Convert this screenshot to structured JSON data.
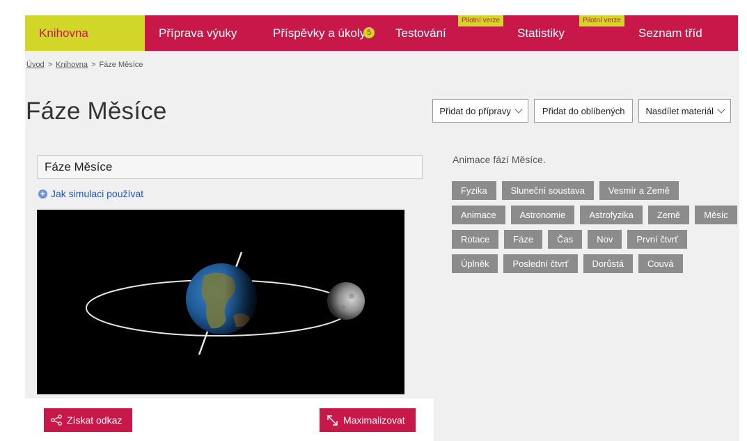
{
  "nav": {
    "items": [
      {
        "label": "Knihovna",
        "active": true
      },
      {
        "label": "Příprava výuky"
      },
      {
        "label": "Příspěvky a úkoly",
        "badge": "5"
      },
      {
        "label": "Testování",
        "pilot": "Pilotní verze"
      },
      {
        "label": "Statistiky",
        "pilot": "Pilotní verze"
      },
      {
        "label": "Seznam tříd"
      }
    ]
  },
  "breadcrumb": {
    "home": "Úvod",
    "sep1": ">",
    "library": "Knihovna",
    "sep2": ">",
    "current": "Fáze Měsíce"
  },
  "page_title": "Fáze Měsíce",
  "actions": {
    "add_to_prep": "Přidat do přípravy",
    "add_to_fav": "Přidat do oblíbených",
    "share": "Nasdílet materiál"
  },
  "material": {
    "title": "Fáze Měsíce",
    "howto": "Jak simulaci používat",
    "get_link": "Získat odkaz",
    "maximize": "Maximalizovat"
  },
  "description": "Animace fází Měsíce.",
  "tags": [
    "Fyzika",
    "Sluneční soustava",
    "Vesmír a Země",
    "Animace",
    "Astronomie",
    "Astrofyzika",
    "Země",
    "Měsíc",
    "Rotace",
    "Fáze",
    "Čas",
    "Nov",
    "První čtvrť",
    "Úplněk",
    "Poslední čtvrť",
    "Dorůstá",
    "Couvá"
  ],
  "colors": {
    "brand_red": "#c8184a",
    "brand_yellow": "#d2d629",
    "tag_gray": "#8c8c8c"
  },
  "icons": {
    "howto": "plus-circle-icon",
    "share": "share-icon",
    "maximize": "expand-arrow-icon",
    "dropdown": "chevron-down-icon"
  }
}
